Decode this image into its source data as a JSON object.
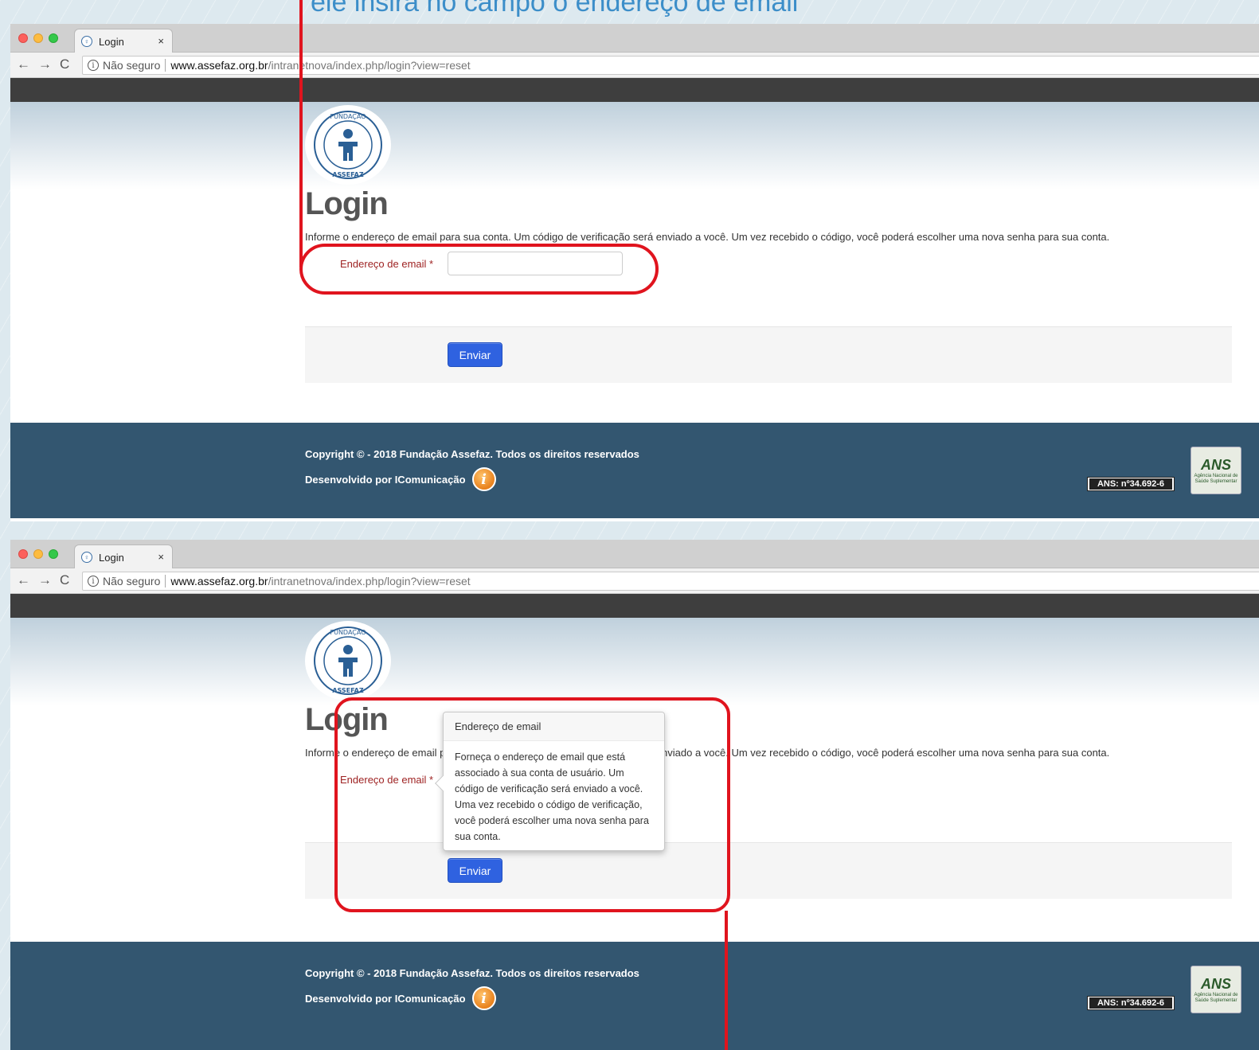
{
  "caption": "ele insira no campo o endereço de email",
  "browser": {
    "tab_title": "Login",
    "tab_close": "×",
    "not_secure": "Não seguro",
    "url_host": "www.assefaz.org.br",
    "url_path": "/intranetnova/index.php/login?view=reset"
  },
  "logo": {
    "top_text": "FUNDAÇÃO",
    "bottom_text": "ASSEFAZ"
  },
  "page": {
    "title": "Login",
    "description": "Informe o endereço de email para sua conta. Um código de verificação será enviado a você. Um vez recebido o código, você poderá escolher uma nova senha para sua conta.",
    "email_label": "Endereço de email *",
    "email_value": "",
    "submit_label": "Enviar"
  },
  "popover": {
    "title": "Endereço de email",
    "body": "Forneça o endereço de email que está associado à sua conta de usuário. Um código de verificação será enviado a você. Uma vez recebido o código de verificação, você poderá escolher uma nova senha para sua conta."
  },
  "footer": {
    "copyright": "Copyright © - 2018 Fundação Assefaz. Todos os direitos reservados",
    "developed_by": "Desenvolvido por IComunicação",
    "ans_number": "ANS: nº34.692-6",
    "ans_logo_mark": "ANS",
    "ans_logo_sub": "Agência Nacional de Saúde Suplementar"
  },
  "colors": {
    "highlight": "#e0141e",
    "footer_bg": "#335670",
    "button_bg": "#2f62e0",
    "label_red": "#9e2222"
  }
}
